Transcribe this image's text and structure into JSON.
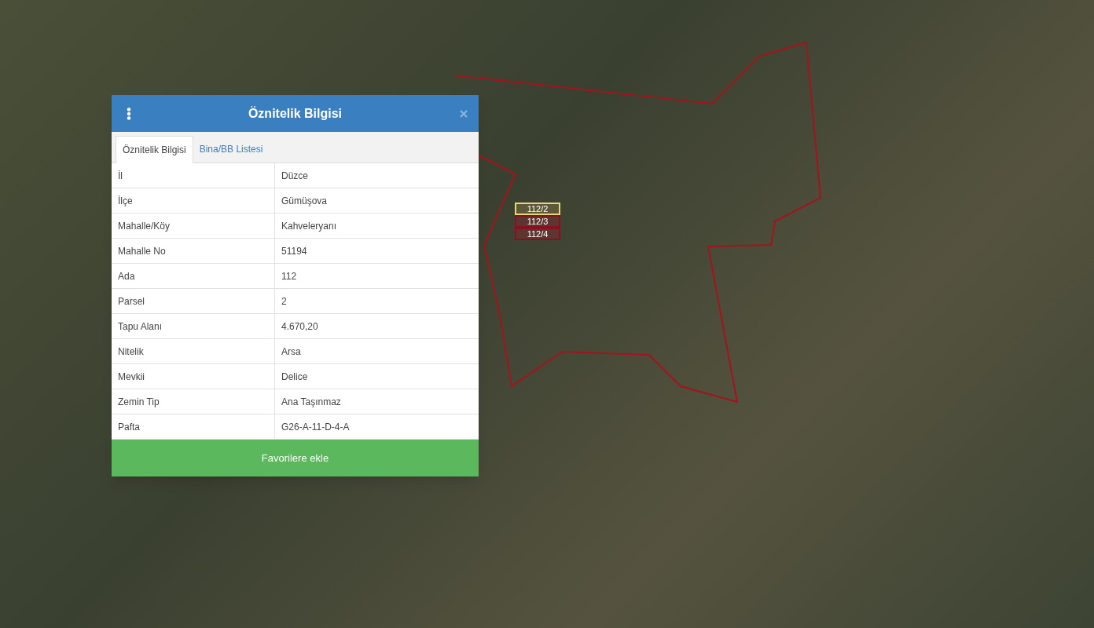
{
  "dialog": {
    "title": "Öznitelik Bilgisi",
    "tabs": [
      {
        "label": "Öznitelik Bilgisi",
        "selected": true
      },
      {
        "label": "Bina/BB Listesi",
        "selected": false
      }
    ],
    "rows": [
      {
        "label": "İl",
        "value": "Düzce"
      },
      {
        "label": "İlçe",
        "value": "Gümüşova"
      },
      {
        "label": "Mahalle/Köy",
        "value": "Kahveleryanı"
      },
      {
        "label": "Mahalle No",
        "value": "51194"
      },
      {
        "label": "Ada",
        "value": "112"
      },
      {
        "label": "Parsel",
        "value": "2"
      },
      {
        "label": "Tapu Alanı",
        "value": "4.670,20"
      },
      {
        "label": "Nitelik",
        "value": "Arsa"
      },
      {
        "label": "Mevkii",
        "value": "Delice"
      },
      {
        "label": "Zemin Tip",
        "value": "Ana Taşınmaz"
      },
      {
        "label": "Pafta",
        "value": "G26-A-11-D-4-A"
      }
    ],
    "button": "Favorilere ekle"
  },
  "parcels": [
    {
      "label": "112/2",
      "selected": true
    },
    {
      "label": "112/3",
      "selected": false
    },
    {
      "label": "112/4",
      "selected": false
    }
  ]
}
